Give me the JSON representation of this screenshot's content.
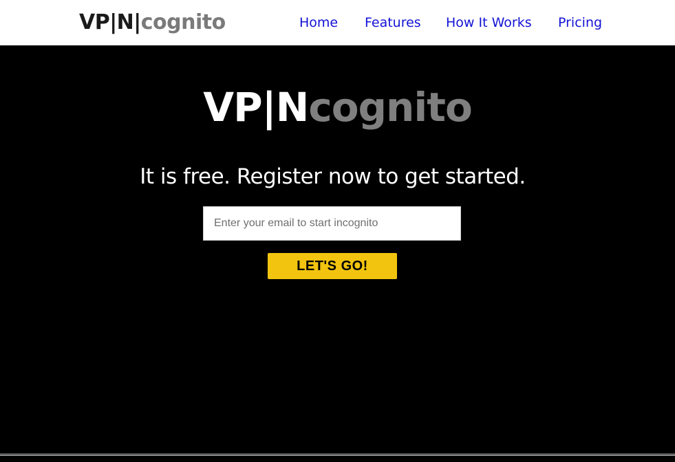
{
  "nav": {
    "logo_prefix": "VP|N|",
    "logo_suffix": "cognito",
    "links": [
      {
        "label": "Home"
      },
      {
        "label": "Features"
      },
      {
        "label": "How It Works"
      },
      {
        "label": "Pricing"
      }
    ],
    "link_color": "#1212d6"
  },
  "hero": {
    "logo_prefix": "VP|N",
    "logo_suffix": "cognito",
    "tagline": "It is free. Register now to get started.",
    "email_placeholder": "Enter your email to start incognito",
    "email_value": "",
    "cta_label": "LET'S GO!",
    "cta_color": "#f2c40f",
    "background_color": "#000000"
  }
}
